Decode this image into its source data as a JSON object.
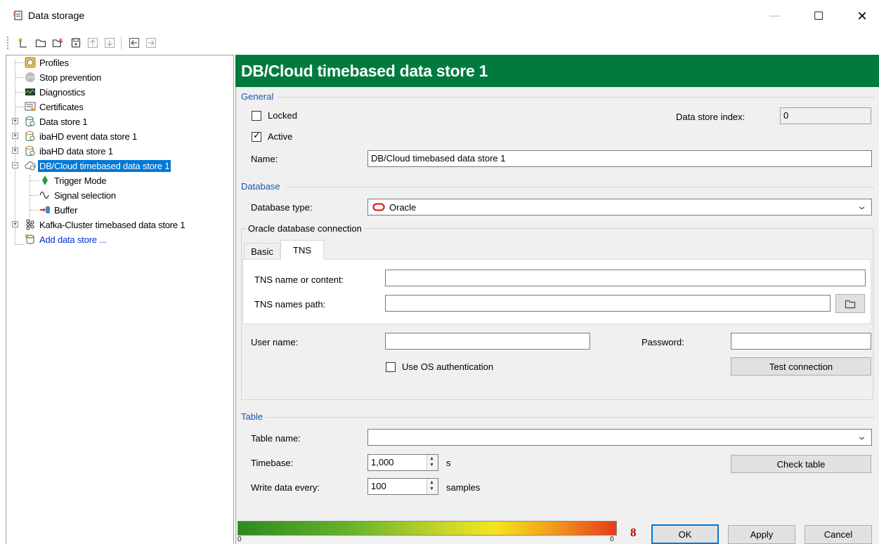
{
  "window": {
    "title": "Data storage",
    "minimize_glyph": "—",
    "maximize_glyph": "☐",
    "close_glyph": "✕"
  },
  "toolbar": {
    "icons": [
      "new-icon",
      "open-folder-icon",
      "import-icon",
      "save-icon",
      "move-up-icon",
      "move-down-icon",
      "move-left-icon",
      "move-right-icon"
    ]
  },
  "tree": {
    "items": [
      {
        "label": "Profiles",
        "icon": "profiles-icon"
      },
      {
        "label": "Stop prevention",
        "icon": "stop-icon"
      },
      {
        "label": "Diagnostics",
        "icon": "diagnostics-icon"
      },
      {
        "label": "Certificates",
        "icon": "certificate-icon"
      },
      {
        "label": "Data store 1",
        "icon": "data-store-icon"
      },
      {
        "label": "ibaHD event data store 1",
        "icon": "hd-event-store-icon"
      },
      {
        "label": "ibaHD data store 1",
        "icon": "hd-store-icon"
      },
      {
        "label": "DB/Cloud timebased data store 1",
        "icon": "db-cloud-icon"
      },
      {
        "label": "Trigger Mode",
        "icon": "trigger-icon"
      },
      {
        "label": "Signal selection",
        "icon": "signal-icon"
      },
      {
        "label": "Buffer",
        "icon": "buffer-icon"
      },
      {
        "label": "Kafka-Cluster timebased data store 1",
        "icon": "kafka-icon"
      },
      {
        "label": "Add data store ...",
        "icon": "add-store-icon"
      }
    ]
  },
  "header": {
    "title": "DB/Cloud timebased data store 1"
  },
  "general": {
    "title": "General",
    "locked_label": "Locked",
    "active_label": "Active",
    "index_label": "Data store index:",
    "index_value": "0",
    "name_label": "Name:",
    "name_value": "DB/Cloud timebased data store 1"
  },
  "database": {
    "title": "Database",
    "type_label": "Database type:",
    "type_value": "Oracle",
    "connection_title": "Oracle database connection",
    "tabs": [
      {
        "label": "Basic"
      },
      {
        "label": "TNS"
      }
    ],
    "tns_name_label": "TNS name or content:",
    "tns_name_value": "",
    "tns_path_label": "TNS names path:",
    "tns_path_value": "",
    "user_label": "User name:",
    "user_value": "",
    "password_label": "Password:",
    "password_value": "",
    "os_auth_label": "Use OS authentication",
    "test_button": "Test connection"
  },
  "table": {
    "title": "Table",
    "name_label": "Table name:",
    "name_value": "",
    "timebase_label": "Timebase:",
    "timebase_value": "1,000",
    "timebase_unit": "s",
    "write_label": "Write data every:",
    "write_value": "100",
    "write_unit": "samples",
    "check_button": "Check table"
  },
  "footer": {
    "gradient_min": "0",
    "gradient_max": "0",
    "badge": "8",
    "ok": "OK",
    "apply": "Apply",
    "cancel": "Cancel"
  },
  "colors": {
    "header_bg": "#007a3d",
    "section_title": "#1a57b5",
    "selection": "#0078d7",
    "oracle_red": "#e0201b"
  }
}
